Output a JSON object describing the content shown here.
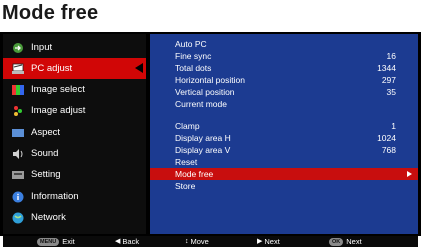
{
  "title": "Mode free",
  "sidebar": {
    "items": [
      {
        "label": "Input",
        "icon": "input-icon"
      },
      {
        "label": "PC adjust",
        "icon": "pc-adjust-icon",
        "selected": true
      },
      {
        "label": "Image select",
        "icon": "image-select-icon"
      },
      {
        "label": "Image adjust",
        "icon": "image-adjust-icon"
      },
      {
        "label": "Aspect",
        "icon": "aspect-icon"
      },
      {
        "label": "Sound",
        "icon": "sound-icon"
      },
      {
        "label": "Setting",
        "icon": "setting-icon"
      },
      {
        "label": "Information",
        "icon": "information-icon"
      },
      {
        "label": "Network",
        "icon": "network-icon"
      }
    ]
  },
  "panel": {
    "rows": [
      {
        "label": "Auto PC",
        "value": ""
      },
      {
        "label": "Fine sync",
        "value": "16"
      },
      {
        "label": "Total dots",
        "value": "1344"
      },
      {
        "label": "Horizontal position",
        "value": "297"
      },
      {
        "label": "Vertical position",
        "value": "35"
      },
      {
        "label": "Current mode",
        "value": ""
      },
      {
        "label": "Clamp",
        "value": "1"
      },
      {
        "label": "Display area H",
        "value": "1024"
      },
      {
        "label": "Display area V",
        "value": "768"
      },
      {
        "label": "Reset",
        "value": ""
      },
      {
        "label": "Mode free",
        "value": "",
        "highlighted": true
      },
      {
        "label": "Store",
        "value": ""
      }
    ]
  },
  "footer": {
    "exit_key": "MENU",
    "exit_label": "Exit",
    "back_label": "Back",
    "move_label": "Move",
    "next_label": "Next",
    "ok_key": "OK",
    "ok_next_label": "Next"
  },
  "colors": {
    "selected_bg": "#d10606",
    "panel_bg": "#1c3b91",
    "highlight_bg": "#c80e0e"
  }
}
